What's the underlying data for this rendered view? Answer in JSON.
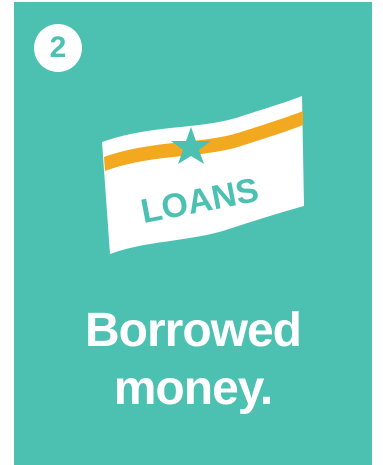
{
  "colors": {
    "teal": "#4CC1B2",
    "white": "#FFFFFF",
    "orange": "#F2A91F"
  },
  "step": {
    "number": "2"
  },
  "illustration": {
    "icon": "loan-banner-icon",
    "star_icon": "star-icon",
    "label": "LOANS"
  },
  "caption": {
    "line1": "Borrowed",
    "line2": "money."
  }
}
